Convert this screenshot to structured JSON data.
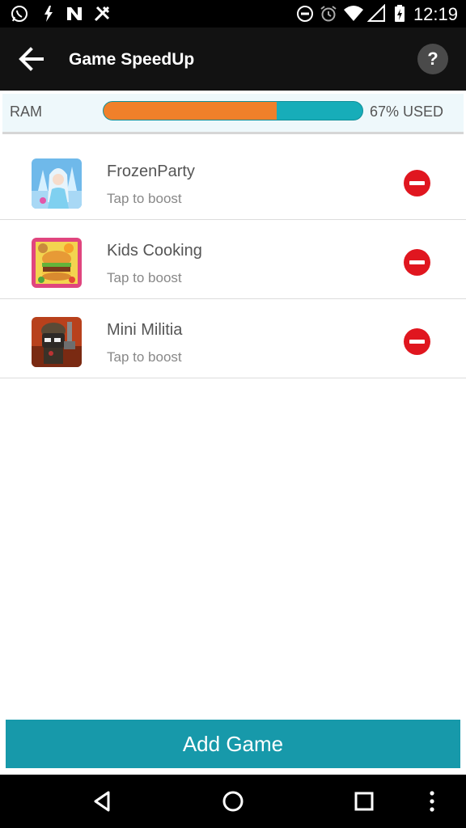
{
  "status_bar": {
    "time": "12:19",
    "left_icons": [
      "whatsapp-icon",
      "flash-icon",
      "news-icon",
      "fork-icon"
    ],
    "right_icons": [
      "do-not-disturb-icon",
      "alarm-icon",
      "wifi-icon",
      "signal-icon",
      "battery-icon"
    ]
  },
  "app_bar": {
    "title": "Game SpeedUp",
    "help_label": "?"
  },
  "ram": {
    "label": "RAM",
    "used_fraction": 0.67,
    "used_text": "67% USED",
    "colors": {
      "used": "#f0802a",
      "free": "#17adb9"
    }
  },
  "games": [
    {
      "name": "FrozenParty",
      "subtitle": "Tap to boost",
      "icon": "frozen-party-icon"
    },
    {
      "name": "Kids Cooking",
      "subtitle": "Tap to boost",
      "icon": "kids-cooking-icon"
    },
    {
      "name": "Mini Militia",
      "subtitle": "Tap to boost",
      "icon": "mini-militia-icon"
    }
  ],
  "add_button": {
    "label": "Add Game",
    "color": "#1799aa"
  },
  "nav_bar": {
    "buttons": [
      "back-icon",
      "home-icon",
      "recents-icon",
      "menu-icon"
    ]
  }
}
